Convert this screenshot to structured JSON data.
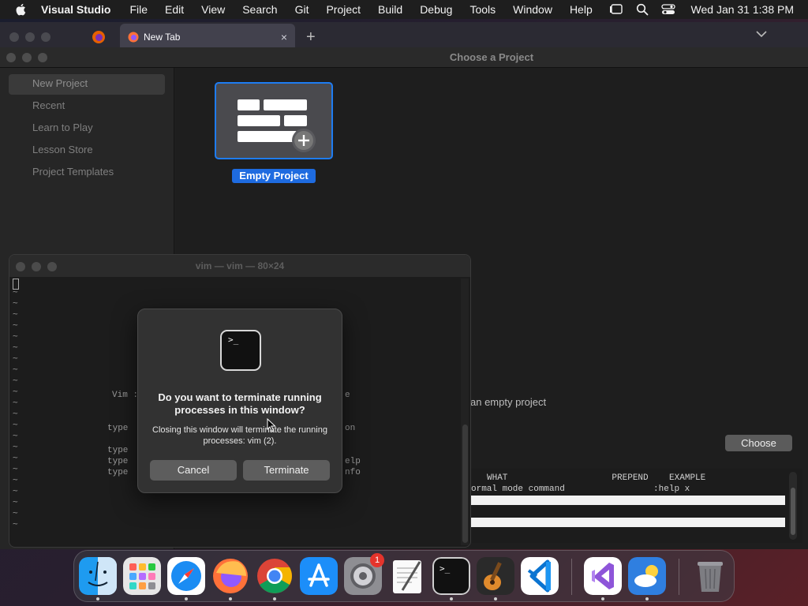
{
  "menubar": {
    "app_name": "Visual Studio",
    "items": [
      "File",
      "Edit",
      "View",
      "Search",
      "Git",
      "Project",
      "Build",
      "Debug",
      "Tools",
      "Window",
      "Help"
    ],
    "clock": "Wed Jan 31  1:38 PM"
  },
  "browser": {
    "tab_title": "New Tab",
    "tab_close": "×",
    "new_tab": "+"
  },
  "visual_studio": {
    "window_title": "Choose a Project",
    "sidebar": [
      {
        "label": "New Project",
        "selected": true
      },
      {
        "label": "Recent"
      },
      {
        "label": "Learn to Play"
      },
      {
        "label": "Lesson Store"
      },
      {
        "label": "Project Templates"
      }
    ],
    "template_caption": "Empty Project",
    "description": "an empty project",
    "choose_button": "Choose"
  },
  "terminal": {
    "window_title": "vim — vim — 80×24",
    "text_fragments": {
      "vim": "Vim :",
      "type1": "type",
      "type2": "type",
      "type3": "type",
      "type4": "type",
      "e": "e",
      "on": "on",
      "elp": "elp",
      "nfo": "nfo"
    }
  },
  "vim_help": {
    "header": "WHAT                    PREPEND    EXAMPLE",
    "row1": "ormal mode command                 :help x"
  },
  "dialog": {
    "title": "Do you want to terminate running processes in this window?",
    "message": "Closing this window will terminate the running processes: vim (2).",
    "cancel_button": "Cancel",
    "terminate_button": "Terminate",
    "icon_prompt": ">_"
  },
  "dock": {
    "items": [
      "Finder",
      "Launchpad",
      "Safari",
      "Firefox",
      "Chrome",
      "App Store",
      "System Settings",
      "TextEdit",
      "Terminal",
      "GarageBand",
      "Visual Studio Code",
      "Visual Studio",
      "Weather",
      "Trash"
    ],
    "settings_badge": "1"
  },
  "colors": {
    "accent": "#1e7cf2",
    "badge": "#e5342c"
  }
}
